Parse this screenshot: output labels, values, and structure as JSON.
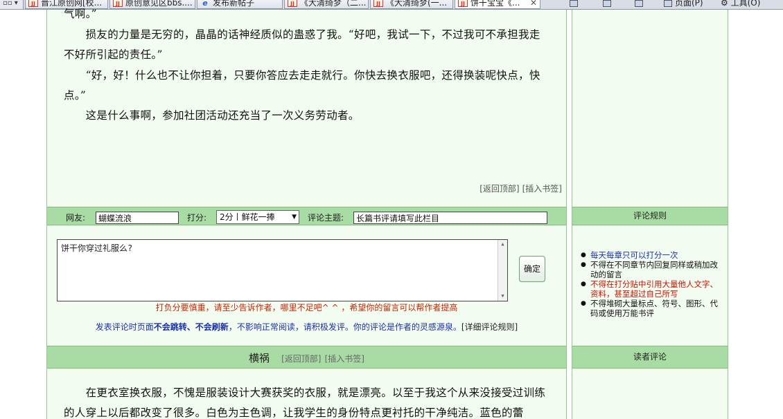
{
  "tabs": [
    {
      "label": "晋江原创网[校..."
    },
    {
      "label": "原创意见区bbs...."
    },
    {
      "label": "发布新帖子"
    },
    {
      "label": "《大清绮梦（二..."
    },
    {
      "label": "《大清绮梦(一..."
    },
    {
      "label": "饼干宝宝《..."
    }
  ],
  "toolbar": {
    "page_label": "页面(P)",
    "tools_label": "工具(O)"
  },
  "article": {
    "paragraphs": [
      "气啊。”",
      "　　损友的力量是无穷的，晶晶的话神经质似的蛊惑了我。“好吧，我试一下，不过我可不承担我走不好所引起的责任。”",
      "　　“好，好！什么也不让你担着，只要你答应去走走就行。你快去换衣服吧，还得换装呢快点，快点。”",
      "　　这是什么事啊，参加社团活动还充当了一次义务劳动者。"
    ],
    "back_to_top": "[返回顶部]",
    "insert_bookmark": "[插入书签]"
  },
  "form": {
    "netizen_label": "网友:",
    "netizen_value": "蝴蝶流浪",
    "score_label": "打分:",
    "score_value": "2分丨鲜花一捧",
    "subject_label": "评论主题:",
    "subject_value": "长篇书评请填写此栏目",
    "comment_value": "饼干你穿过礼服么?",
    "confirm_label": "确定",
    "warning": "打负分要慎重，请至少告诉作者，哪里不足吧^ ^ ，希望你的留言可以帮作者提高",
    "note_part1": "发表评论时页面",
    "note_bold": "不会跳转、不会刷新",
    "note_part2": "，不影响正常阅读，请积极发评。你的评论是作者的灵感源泉。",
    "note_link": "[详细评论规则]"
  },
  "chapter": {
    "title": "横祸",
    "back_to_top": "[返回顶部]",
    "insert_bookmark": "[插入书签]",
    "paragraph": "　　在更衣室换衣服，不愧是服装设计大赛获奖的衣服，就是漂亮。以至于我这个从来没接受过训练的人穿上以后都改变了很多。白色为主色调，让我学生的身份特点更衬托的干净纯洁。蓝色的蕾"
  },
  "sidebar": {
    "rules_title": "评论规则",
    "rules": [
      {
        "text": "每天每章只可以打分一次",
        "color": "blue"
      },
      {
        "text": "不得在不同章节内回复同样或稍加改动的留言",
        "color": "black"
      },
      {
        "text": "不得在打分贴中引用大量他人文字、资料，甚至超过自己所写",
        "color": "red"
      },
      {
        "text": "不得堆砌大量标点、符号、图形、代码或使用万能书评",
        "color": "black"
      }
    ],
    "reader_title": "读者评论"
  },
  "colors": {
    "bar_green": "#a9dca4",
    "pale_green": "#f3fcf1",
    "border_green": "#8fc68f",
    "warn_red": "#cc2200",
    "note_blue": "#1a2fa8"
  }
}
